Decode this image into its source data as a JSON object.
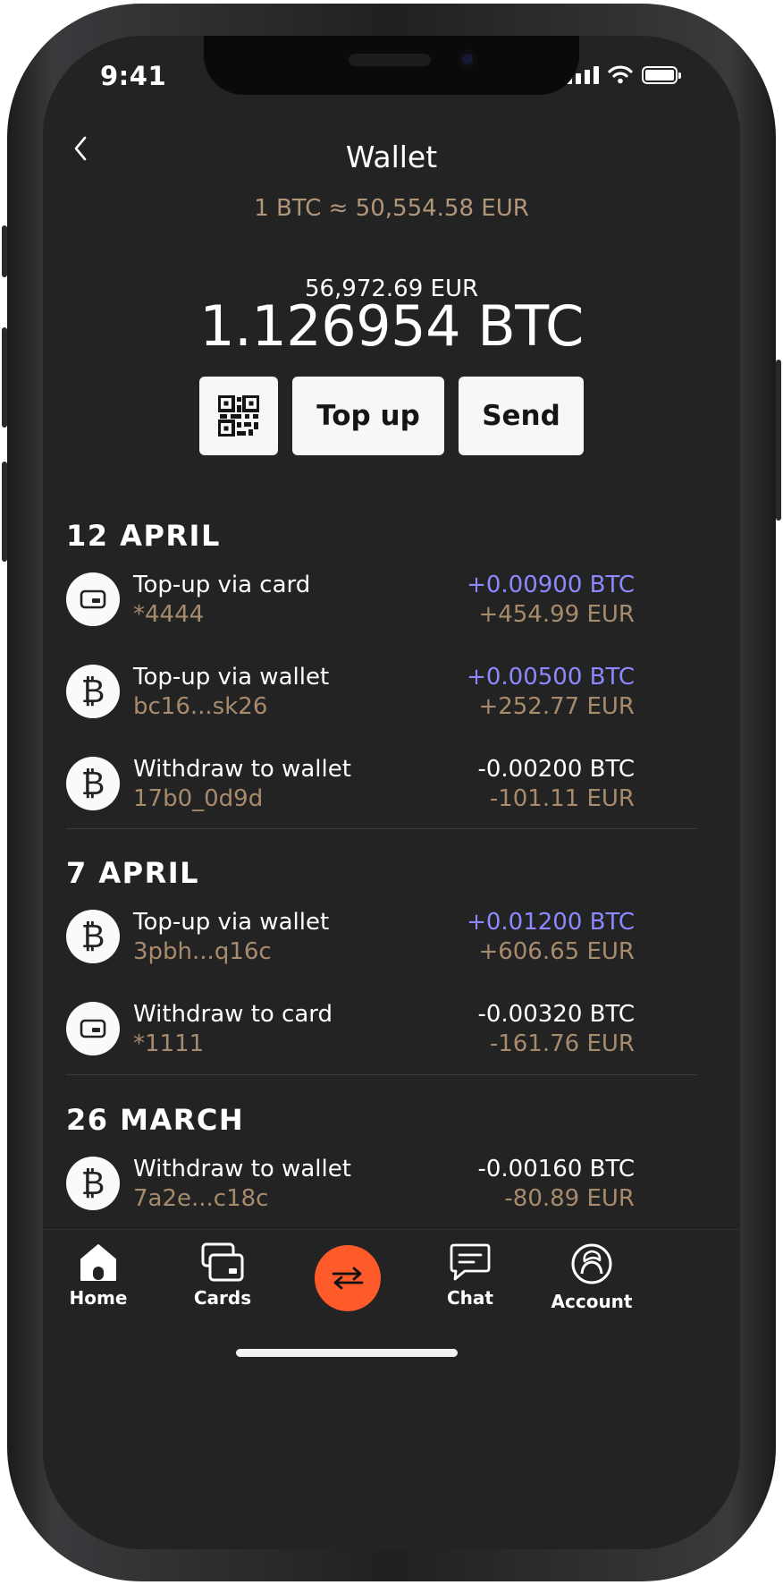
{
  "status_bar": {
    "time": "9:41"
  },
  "header": {
    "title": "Wallet",
    "rate": "1 BTC ≈ 50,554.58 EUR"
  },
  "balance": {
    "fiat": "56,972.69 EUR",
    "btc": "1.126954 BTC"
  },
  "actions": {
    "top_up_label": "Top up",
    "send_label": "Send"
  },
  "sections": [
    {
      "title": "12 APRIL",
      "transactions": [
        {
          "icon": "card-icon",
          "title": "Top-up via card",
          "subtitle": "*4444",
          "btc": "+0.00900 BTC",
          "eur": "+454.99 EUR",
          "positive": true
        },
        {
          "icon": "bitcoin-icon",
          "title": "Top-up via wallet",
          "subtitle": "bc16...sk26",
          "btc": "+0.00500 BTC",
          "eur": "+252.77 EUR",
          "positive": true
        },
        {
          "icon": "bitcoin-icon",
          "title": "Withdraw to wallet",
          "subtitle": "17b0_0d9d",
          "btc": "-0.00200 BTC",
          "eur": "-101.11 EUR",
          "positive": false
        }
      ]
    },
    {
      "title": "7 APRIL",
      "transactions": [
        {
          "icon": "bitcoin-icon",
          "title": "Top-up via wallet",
          "subtitle": "3pbh...q16c",
          "btc": "+0.01200 BTC",
          "eur": "+606.65 EUR",
          "positive": true
        },
        {
          "icon": "card-icon",
          "title": "Withdraw to card",
          "subtitle": "*1111",
          "btc": "-0.00320 BTC",
          "eur": "-161.76 EUR",
          "positive": false
        }
      ]
    },
    {
      "title": "26 MARCH",
      "transactions": [
        {
          "icon": "bitcoin-icon",
          "title": "Withdraw to wallet",
          "subtitle": "7a2e...c18c",
          "btc": "-0.00160 BTC",
          "eur": "-80.89 EUR",
          "positive": false
        }
      ]
    }
  ],
  "tabbar": {
    "home": "Home",
    "cards": "Cards",
    "chat": "Chat",
    "account": "Account"
  },
  "colors": {
    "background": "#232323",
    "accent_orange": "#ff5a2a",
    "positive_btc": "#8c88ff",
    "muted_gold": "#a78b6c"
  }
}
